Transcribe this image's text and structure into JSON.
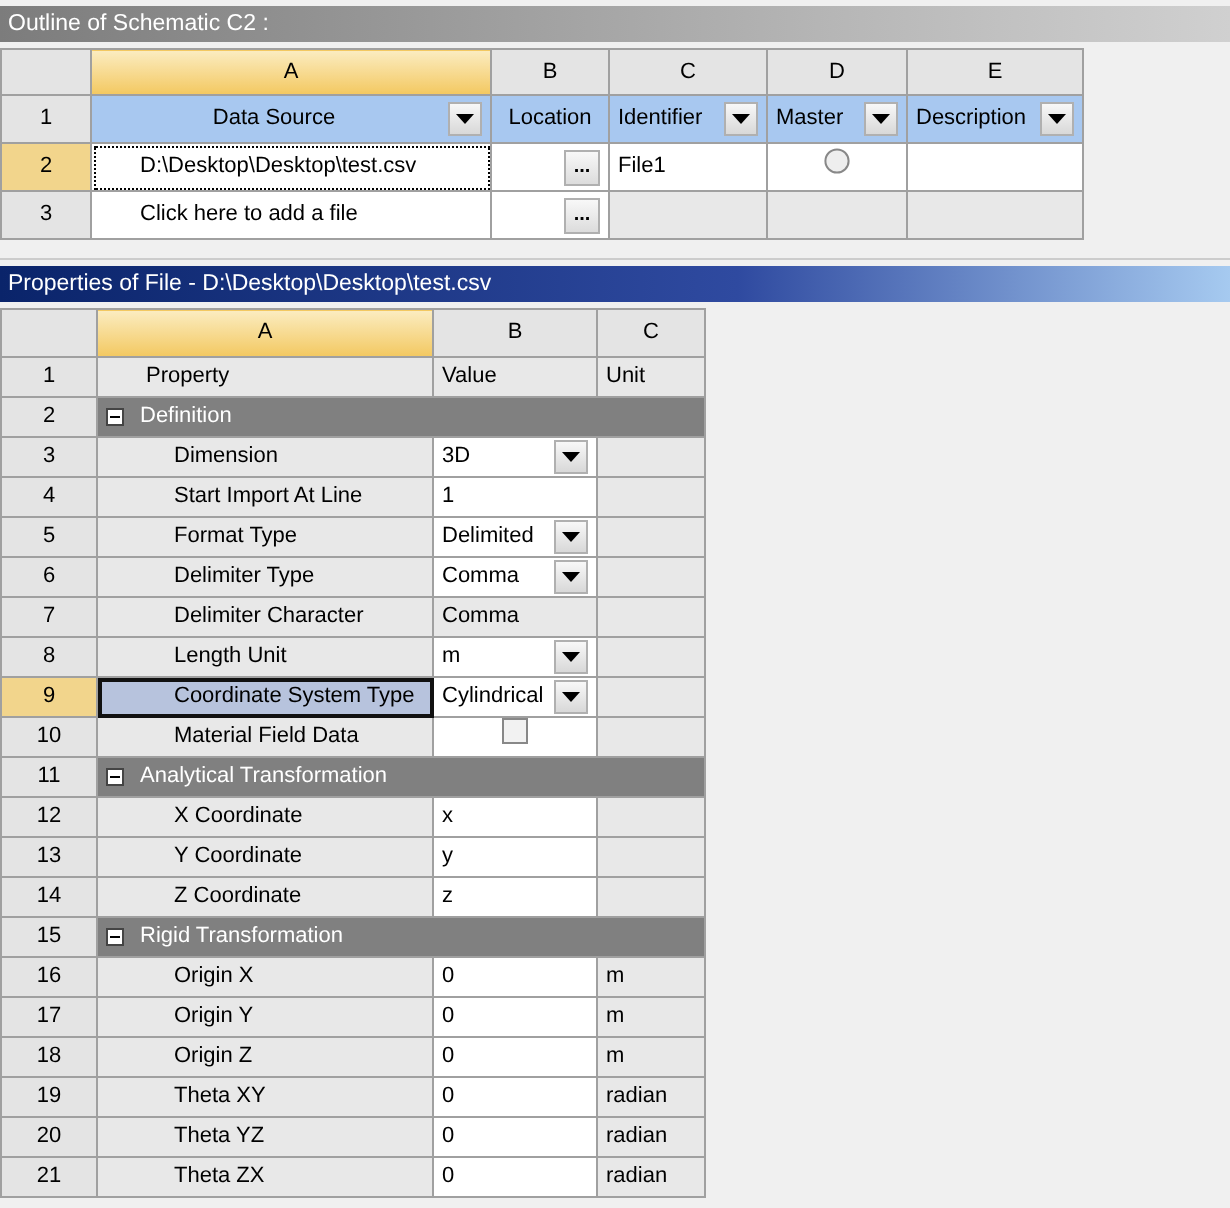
{
  "outline": {
    "title": "Outline of Schematic C2 :",
    "column_letters": [
      {
        "label": "A",
        "selected": true
      },
      {
        "label": "B",
        "selected": false
      },
      {
        "label": "C",
        "selected": false
      },
      {
        "label": "D",
        "selected": false
      },
      {
        "label": "E",
        "selected": false
      }
    ],
    "header": {
      "number": "1",
      "cells": [
        {
          "label": "Data Source",
          "dropdown": true
        },
        {
          "label": "Location",
          "dropdown": false
        },
        {
          "label": "Identifier",
          "dropdown": true
        },
        {
          "label": "Master",
          "dropdown": true
        },
        {
          "label": "Description",
          "dropdown": true
        }
      ]
    },
    "rows": [
      {
        "number": "2",
        "selected": true,
        "source": "D:\\Desktop\\Desktop\\test.csv",
        "browse": "...",
        "identifier": "File1",
        "master": {
          "checked": false
        }
      },
      {
        "number": "3",
        "selected": false,
        "source": "Click here to add a file",
        "browse": "..."
      }
    ]
  },
  "properties": {
    "title": "Properties of File - D:\\Desktop\\Desktop\\test.csv",
    "column_letters": [
      {
        "label": "A",
        "selected": true
      },
      {
        "label": "B",
        "selected": false
      },
      {
        "label": "C",
        "selected": false
      }
    ],
    "rows": [
      {
        "number": "1",
        "kind": "header",
        "selected": false,
        "label": "Property",
        "value": "Value",
        "unit": "Unit"
      },
      {
        "number": "2",
        "kind": "group",
        "selected": false,
        "expanded": true,
        "label": "Definition"
      },
      {
        "number": "3",
        "kind": "property",
        "selected": false,
        "label": "Dimension",
        "value": {
          "kind": "dropdown",
          "text": "3D"
        },
        "editable": true
      },
      {
        "number": "4",
        "kind": "property",
        "selected": false,
        "label": "Start Import At Line",
        "value": {
          "kind": "text",
          "text": "1"
        },
        "editable": true
      },
      {
        "number": "5",
        "kind": "property",
        "selected": false,
        "label": "Format Type",
        "value": {
          "kind": "dropdown",
          "text": "Delimited"
        },
        "editable": true
      },
      {
        "number": "6",
        "kind": "property",
        "selected": false,
        "label": "Delimiter Type",
        "value": {
          "kind": "dropdown",
          "text": "Comma"
        },
        "editable": true
      },
      {
        "number": "7",
        "kind": "property",
        "selected": false,
        "label": "Delimiter Character",
        "value": {
          "kind": "text",
          "text": "Comma"
        },
        "editable": false
      },
      {
        "number": "8",
        "kind": "property",
        "selected": false,
        "label": "Length Unit",
        "value": {
          "kind": "dropdown",
          "text": "m"
        },
        "editable": true
      },
      {
        "number": "9",
        "kind": "property",
        "selected": true,
        "label": "Coordinate System Type",
        "value": {
          "kind": "dropdown",
          "text": "Cylindrical"
        },
        "editable": true
      },
      {
        "number": "10",
        "kind": "property",
        "selected": false,
        "label": "Material Field Data",
        "value": {
          "kind": "checkbox",
          "checked": false
        },
        "editable": true
      },
      {
        "number": "11",
        "kind": "group",
        "selected": false,
        "expanded": true,
        "label": "Analytical Transformation"
      },
      {
        "number": "12",
        "kind": "property",
        "selected": false,
        "label": "X Coordinate",
        "value": {
          "kind": "text",
          "text": "x"
        },
        "editable": true
      },
      {
        "number": "13",
        "kind": "property",
        "selected": false,
        "label": "Y Coordinate",
        "value": {
          "kind": "text",
          "text": "y"
        },
        "editable": true
      },
      {
        "number": "14",
        "kind": "property",
        "selected": false,
        "label": "Z Coordinate",
        "value": {
          "kind": "text",
          "text": "z"
        },
        "editable": true
      },
      {
        "number": "15",
        "kind": "group",
        "selected": false,
        "expanded": true,
        "label": "Rigid Transformation"
      },
      {
        "number": "16",
        "kind": "property",
        "selected": false,
        "label": "Origin X",
        "value": {
          "kind": "text",
          "text": "0"
        },
        "editable": true,
        "unit": "m"
      },
      {
        "number": "17",
        "kind": "property",
        "selected": false,
        "label": "Origin Y",
        "value": {
          "kind": "text",
          "text": "0"
        },
        "editable": true,
        "unit": "m"
      },
      {
        "number": "18",
        "kind": "property",
        "selected": false,
        "label": "Origin Z",
        "value": {
          "kind": "text",
          "text": "0"
        },
        "editable": true,
        "unit": "m"
      },
      {
        "number": "19",
        "kind": "property",
        "selected": false,
        "label": "Theta XY",
        "value": {
          "kind": "text",
          "text": "0"
        },
        "editable": true,
        "unit": "radian"
      },
      {
        "number": "20",
        "kind": "property",
        "selected": false,
        "label": "Theta YZ",
        "value": {
          "kind": "text",
          "text": "0"
        },
        "editable": true,
        "unit": "radian"
      },
      {
        "number": "21",
        "kind": "property",
        "selected": false,
        "label": "Theta ZX",
        "value": {
          "kind": "text",
          "text": "0"
        },
        "editable": true,
        "unit": "radian"
      }
    ]
  }
}
